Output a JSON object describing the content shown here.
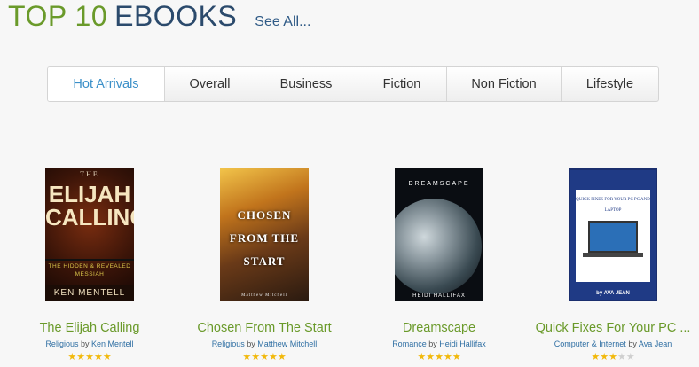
{
  "header": {
    "title_top": "TOP 10",
    "title_rest": "EBOOKS",
    "see_all": "See All..."
  },
  "tabs": [
    {
      "label": "Hot Arrivals",
      "active": true
    },
    {
      "label": "Overall"
    },
    {
      "label": "Business"
    },
    {
      "label": "Fiction"
    },
    {
      "label": "Non Fiction"
    },
    {
      "label": "Lifestyle"
    }
  ],
  "books": [
    {
      "title": "The Elijah Calling",
      "category": "Religious",
      "by": "by",
      "author": "Ken Mentell",
      "rating": 5,
      "cover": {
        "top": "THE",
        "main": "ELIJAH CALLING",
        "sub": "THE HIDDEN & REVEALED MESSIAH",
        "author": "KEN MENTELL"
      }
    },
    {
      "title": "Chosen From The Start",
      "category": "Religious",
      "by": "by",
      "author": "Matthew Mitchell",
      "rating": 5,
      "cover": {
        "main": "CHOSEN FROM THE START",
        "author": "Matthew Mitchell"
      }
    },
    {
      "title": "Dreamscape",
      "category": "Romance",
      "by": "by",
      "author": "Heidi Hallifax",
      "rating": 5,
      "cover": {
        "main": "DREAMSCAPE",
        "author": "HEIDI HALLIFAX"
      }
    },
    {
      "title": "Quick Fixes For Your PC ...",
      "category": "Computer & Internet",
      "by": "by",
      "author": "Ava Jean",
      "rating": 3,
      "cover": {
        "main": "QUICK FIXES FOR YOUR PC PC AND LAPTOP",
        "author": "by AVA JEAN"
      }
    }
  ],
  "colors": {
    "green": "#6a9a2a",
    "navy": "#2b4a6c",
    "link": "#2f6fa3",
    "star": "#f2b90c",
    "star_off": "#cfcfcf"
  }
}
